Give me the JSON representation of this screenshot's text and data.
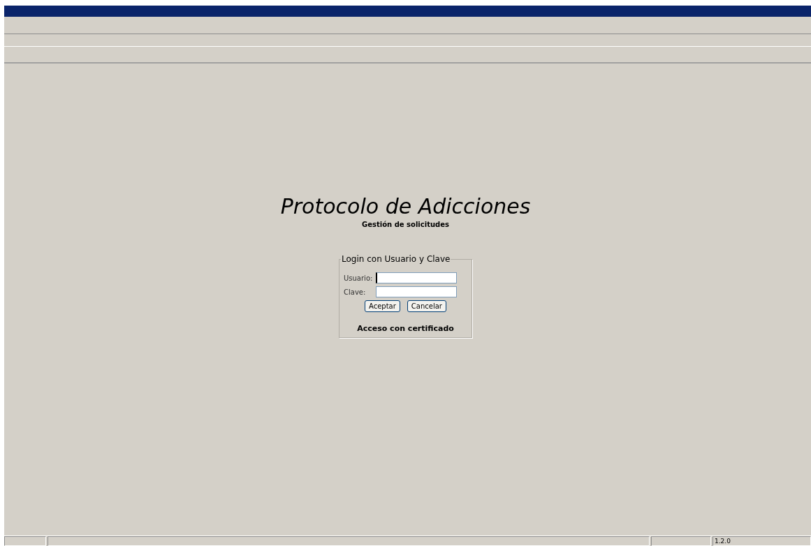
{
  "app": {
    "title": "Protocolo de Adicciones",
    "subtitle": "Gestión de solicitudes"
  },
  "login": {
    "legend": "Login con Usuario y Clave",
    "fields": [
      {
        "label": "Usuario:",
        "focused": true
      },
      {
        "label": "Clave:",
        "focused": false
      }
    ],
    "buttons": [
      "Aceptar",
      "Cancelar"
    ],
    "certificate_link": "Acceso con certificado"
  },
  "status_bar": {
    "version": "1.2.0"
  }
}
